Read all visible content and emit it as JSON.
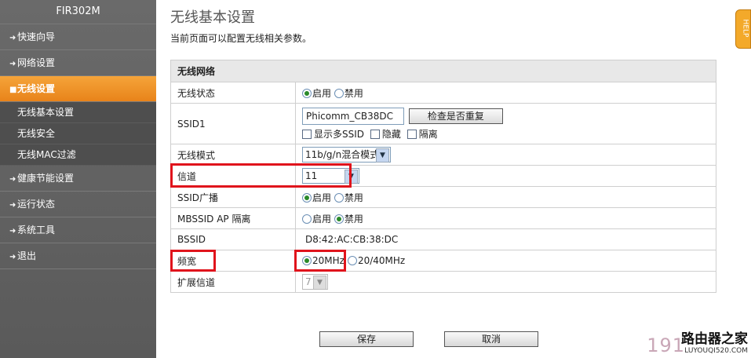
{
  "sidebar": {
    "brand": "FIR302M",
    "items": [
      {
        "label": "快速向导"
      },
      {
        "label": "网络设置"
      },
      {
        "label": "无线设置"
      },
      {
        "label": "健康节能设置"
      },
      {
        "label": "运行状态"
      },
      {
        "label": "系统工具"
      },
      {
        "label": "退出"
      }
    ],
    "subitems": [
      {
        "label": "无线基本设置"
      },
      {
        "label": "无线安全"
      },
      {
        "label": "无线MAC过滤"
      }
    ]
  },
  "page": {
    "title": "无线基本设置",
    "description": "当前页面可以配置无线相关参数。",
    "help_label": "HELP"
  },
  "form": {
    "section_title": "无线网络",
    "wireless_status": {
      "label": "无线状态",
      "on": "启用",
      "off": "禁用",
      "selected": "on"
    },
    "ssid1": {
      "label": "SSID1",
      "value": "Phicomm_CB38DC",
      "check_button": "检查是否重复",
      "show_multi": "显示多SSID",
      "hide": "隐藏",
      "isolate": "隔离"
    },
    "mode": {
      "label": "无线模式",
      "value": "11b/g/n混合模式"
    },
    "channel": {
      "label": "信道",
      "value": "11"
    },
    "ssid_broadcast": {
      "label": "SSID广播",
      "on": "启用",
      "off": "禁用",
      "selected": "on"
    },
    "mbssid_isolate": {
      "label": "MBSSID AP 隔离",
      "on": "启用",
      "off": "禁用",
      "selected": "off"
    },
    "bssid": {
      "label": "BSSID",
      "value": "D8:42:AC:CB:38:DC"
    },
    "bandwidth": {
      "label": "频宽",
      "opt1": "20MHz",
      "opt2": "20/40MHz",
      "selected": "opt1"
    },
    "ext_channel": {
      "label": "扩展信道",
      "value": "7"
    }
  },
  "actions": {
    "save": "保存",
    "cancel": "取消"
  },
  "watermark": {
    "number": "191",
    "name": "路由器之家",
    "url": "LUYOUQI520.COM"
  },
  "colors": {
    "accent": "#E8831A",
    "highlight": "#E0141C",
    "sidebar": "#5A5A5A"
  }
}
